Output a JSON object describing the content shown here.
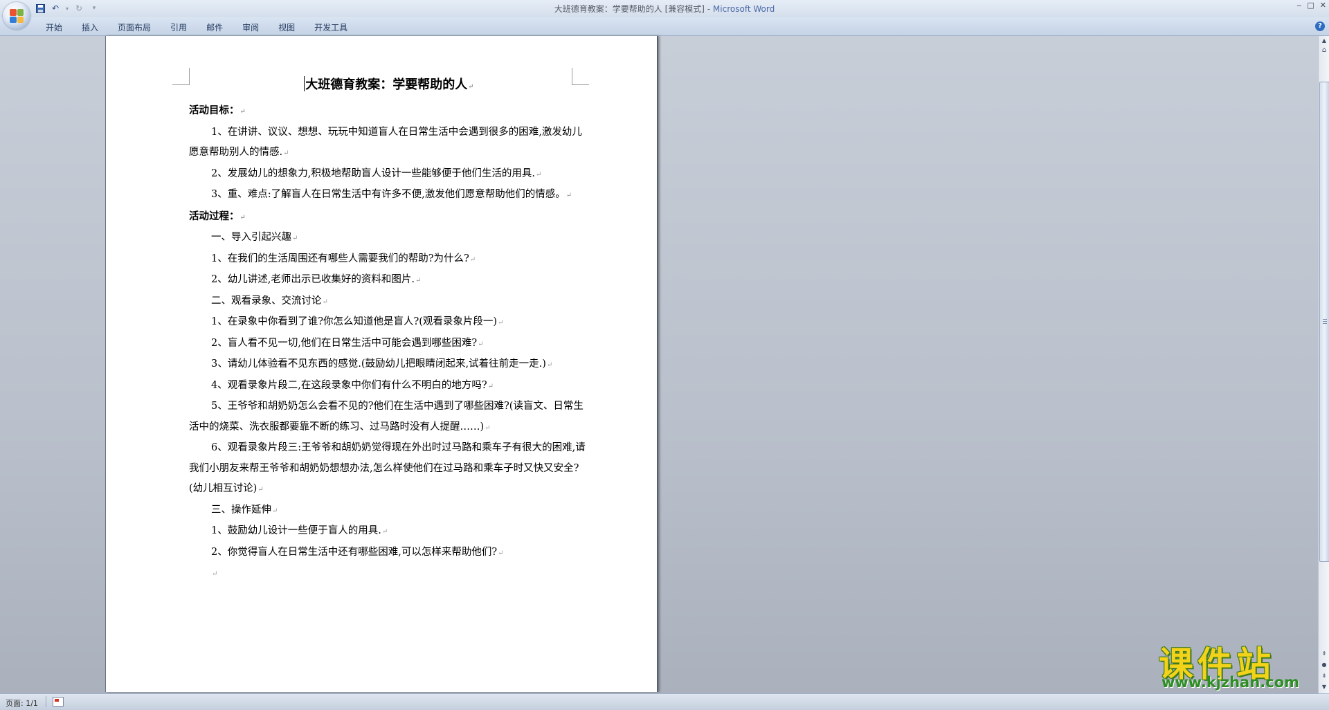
{
  "window": {
    "title": "大班德育教案：学要帮助的人 [兼容模式] - ",
    "app_name": "Microsoft Word"
  },
  "quick_access": {
    "save_icon": "save-icon",
    "undo_icon": "undo-icon",
    "redo_icon": "redo-icon",
    "customize_icon": "chevron-down-icon"
  },
  "ribbon": {
    "tabs": [
      "开始",
      "插入",
      "页面布局",
      "引用",
      "邮件",
      "审阅",
      "视图",
      "开发工具"
    ]
  },
  "document": {
    "title": "大班德育教案：学要帮助的人",
    "paragraph_mark": "↵",
    "paragraphs": [
      {
        "text": "活动目标：",
        "style": "hdr"
      },
      {
        "text": "1、在讲讲、议议、想想、玩玩中知道盲人在日常生活中会遇到很多的困难,激发幼儿愿意帮助别人的情感.",
        "style": "indent"
      },
      {
        "text": "2、发展幼儿的想象力,积极地帮助盲人设计一些能够便于他们生活的用具.",
        "style": "indent"
      },
      {
        "text": "3、重、难点:了解盲人在日常生活中有许多不便,激发他们愿意帮助他们的情感。",
        "style": "indent"
      },
      {
        "text": "活动过程：",
        "style": "hdr"
      },
      {
        "text": "一、导入引起兴趣",
        "style": "indent"
      },
      {
        "text": "1、在我们的生活周围还有哪些人需要我们的帮助?为什么?",
        "style": "indent"
      },
      {
        "text": "2、幼儿讲述,老师出示已收集好的资料和图片.",
        "style": "indent"
      },
      {
        "text": "二、观看录象、交流讨论",
        "style": "indent"
      },
      {
        "text": "1、在录象中你看到了谁?你怎么知道他是盲人?(观看录象片段一)",
        "style": "indent"
      },
      {
        "text": "2、盲人看不见一切,他们在日常生活中可能会遇到哪些困难?",
        "style": "indent"
      },
      {
        "text": "3、请幼儿体验看不见东西的感觉.(鼓励幼儿把眼睛闭起来,试着往前走一走.)",
        "style": "indent"
      },
      {
        "text": "4、观看录象片段二,在这段录象中你们有什么不明白的地方吗?",
        "style": "indent"
      },
      {
        "text": "5、王爷爷和胡奶奶怎么会看不见的?他们在生活中遇到了哪些困难?(读盲文、日常生活中的烧菜、洗衣服都要靠不断的练习、过马路时没有人提醒……)",
        "style": "indent"
      },
      {
        "text": "6、观看录象片段三:王爷爷和胡奶奶觉得现在外出时过马路和乘车子有很大的困难,请我们小朋友来帮王爷爷和胡奶奶想想办法,怎么样使他们在过马路和乘车子时又快又安全?(幼儿相互讨论)",
        "style": "indent"
      },
      {
        "text": "三、操作延伸",
        "style": "indent"
      },
      {
        "text": "1、鼓励幼儿设计一些便于盲人的用具.",
        "style": "indent"
      },
      {
        "text": "2、你觉得盲人在日常生活中还有哪些困难,可以怎样来帮助他们?",
        "style": "indent"
      },
      {
        "text": "",
        "style": "indent"
      }
    ]
  },
  "status": {
    "page": "页面: 1/1"
  },
  "watermark": {
    "text": "课件站",
    "url": "www.kjzhan.com"
  }
}
